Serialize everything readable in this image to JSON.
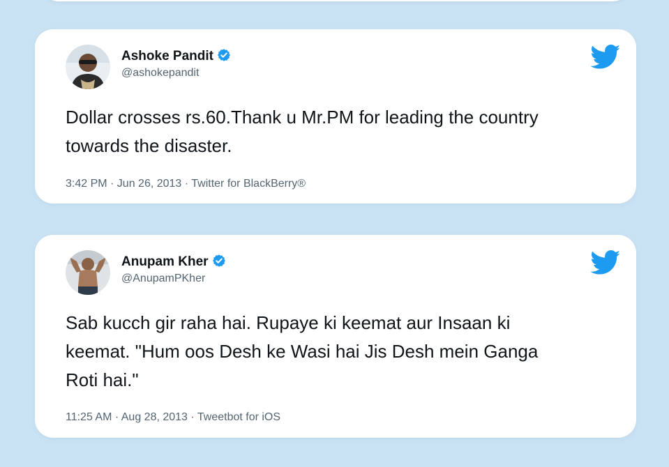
{
  "colors": {
    "background": "#c9e3f5",
    "card": "#ffffff",
    "twitter_blue": "#1d9bf0",
    "text_primary": "#0f1419",
    "text_secondary": "#536471"
  },
  "tweets": [
    {
      "author_name": "Ashoke Pandit",
      "handle": "@ashokepandit",
      "verified": true,
      "text": "Dollar crosses rs.60.Thank u Mr.PM for leading the country towards the disaster.",
      "meta": "3:42 PM · Jun 26, 2013 · Twitter for BlackBerry®",
      "avatar_icon": "person-with-sunglasses-avatar",
      "logo_icon": "twitter-bird-icon"
    },
    {
      "author_name": "Anupam Kher",
      "handle": "@AnupamPKher",
      "verified": true,
      "text": "Sab kucch gir raha hai. Rupaye ki keemat aur Insaan ki keemat. \"Hum oos Desh ke Wasi hai Jis Desh mein Ganga Roti hai.\"",
      "meta": "11:25 AM · Aug 28, 2013 · Tweetbot for iOS",
      "avatar_icon": "person-arms-raised-avatar",
      "logo_icon": "twitter-bird-icon"
    }
  ]
}
